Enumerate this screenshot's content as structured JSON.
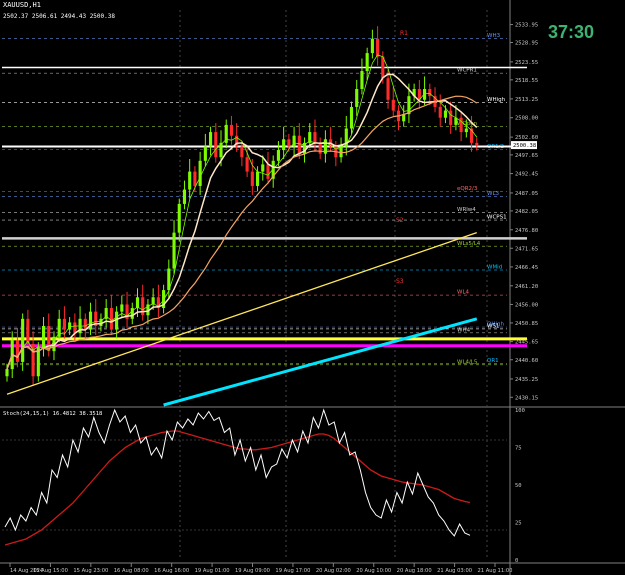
{
  "header": {
    "symbol_title": "XAUUSD,H1",
    "ohlc_readout": "2502.37 2506.61 2494.43 2500.38",
    "timer": "37:30"
  },
  "colors": {
    "background": "#000000",
    "grid": "#1e1e1e",
    "bull": "#7CFC00",
    "bear": "#ff2a2a",
    "ma_fast": "#ffe8c8",
    "ma_mid": "#f4a460",
    "ma_slow": "#ffe65a",
    "ma_long": "#00e5ff",
    "magenta": "#ff00ff",
    "yellow": "#ffff33",
    "timer": "#3cb371",
    "axis_text": "#c8c8c8"
  },
  "chart_data": [
    {
      "type": "candlestick",
      "title": "",
      "price_axis": {
        "range": [
          2428,
          2538
        ],
        "ticks": [
          2533.95,
          2528.95,
          2523.55,
          2518.55,
          2513.25,
          2508.0,
          2502.6,
          2497.65,
          2492.45,
          2487.05,
          2482.05,
          2476.8,
          2471.65,
          2466.45,
          2461.2,
          2456.0,
          2450.85,
          2445.65,
          2440.6,
          2435.25,
          2430.15
        ],
        "current_price": 2500.38
      },
      "time_labels": [
        "14 Aug 2024",
        "15 Aug 15:00",
        "15 Aug 23:00",
        "16 Aug 08:00",
        "16 Aug 16:00",
        "19 Aug 01:00",
        "19 Aug 09:00",
        "19 Aug 17:00",
        "20 Aug 02:00",
        "20 Aug 10:00",
        "20 Aug 18:00",
        "21 Aug 03:00",
        "21 Aug 11:00"
      ],
      "close_series": [
        2438,
        2446,
        2440,
        2452,
        2445,
        2436,
        2444,
        2450,
        2443,
        2447,
        2452,
        2449,
        2451,
        2448,
        2452,
        2449,
        2454,
        2450,
        2452,
        2455,
        2449,
        2454,
        2456,
        2452,
        2455,
        2458,
        2453,
        2456,
        2458,
        2455,
        2460,
        2466,
        2476,
        2484,
        2488,
        2493,
        2489,
        2496,
        2500,
        2504,
        2497,
        2501,
        2506,
        2503,
        2500,
        2497,
        2493,
        2489,
        2493,
        2495,
        2491,
        2496,
        2499,
        2502,
        2500,
        2503,
        2498,
        2501,
        2504,
        2501,
        2498,
        2502,
        2500,
        2497,
        2500,
        2505,
        2511,
        2516,
        2521,
        2526,
        2530,
        2525,
        2519,
        2513,
        2510,
        2507,
        2509,
        2514,
        2516,
        2513,
        2516,
        2514,
        2511,
        2508,
        2510,
        2506,
        2508,
        2504,
        2505,
        2501,
        2500.38
      ],
      "level_lines": [
        {
          "label": "WH3",
          "price": 2530.1
        },
        {
          "label": "WCPR1",
          "price": 2520.4
        },
        {
          "label": "WHigh",
          "price": 2512.2
        },
        {
          "label": "WOpen",
          "price": 2505.6
        },
        {
          "label": "QR1/2",
          "price": 2499.1
        },
        {
          "label": "eQR2/3",
          "price": 2487.4
        },
        {
          "label": "WL3",
          "price": 2486.1
        },
        {
          "label": "WRlw4",
          "price": 2481.6
        },
        {
          "label": "WCPS1",
          "price": 2479.5
        },
        {
          "label": "WLs5/L4",
          "price": 2472.2
        },
        {
          "label": "WMid",
          "price": 2465.6
        },
        {
          "label": "WL4",
          "price": 2458.6
        },
        {
          "label": "QHigh",
          "price": 2449.7
        },
        {
          "label": "WH4",
          "price": 2448.1
        },
        {
          "label": "WS1",
          "price": 2449.2
        },
        {
          "label": "WL4/L5",
          "price": 2439.2
        },
        {
          "label": "QR1",
          "price": 2439.6
        }
      ],
      "marker_labels": [
        "R1",
        "S2",
        "S3"
      ]
    },
    {
      "type": "line",
      "title": "Stoch(24,15,1) 16.4812 38.3518",
      "y_range": [
        0,
        100
      ],
      "ticks": [
        100,
        75,
        50,
        25,
        0
      ],
      "series": [
        {
          "values": [
            22,
            28,
            20,
            30,
            26,
            35,
            30,
            45,
            38,
            60,
            55,
            70,
            62,
            80,
            72,
            88,
            82,
            95,
            85,
            78,
            90,
            100,
            92,
            96,
            85,
            90,
            78,
            82,
            70,
            75,
            68,
            86,
            80,
            92,
            88,
            94,
            90,
            98,
            94,
            99,
            93,
            95,
            85,
            88,
            70,
            80,
            66,
            75,
            60,
            70,
            55,
            62,
            64,
            74,
            68,
            80,
            72,
            86,
            78,
            95,
            88,
            100,
            90,
            92,
            78,
            85,
            70,
            72,
            60,
            45,
            35,
            30,
            28,
            40,
            32,
            45,
            38,
            52,
            44,
            58,
            50,
            42,
            38,
            30,
            26,
            20,
            16,
            24,
            18,
            16.48
          ]
        },
        {
          "values": [
            10,
            11,
            12,
            13,
            14,
            16,
            18,
            20,
            23,
            26,
            29,
            32,
            35,
            38,
            42,
            46,
            50,
            54,
            58,
            62,
            66,
            69,
            72,
            75,
            77,
            79,
            81,
            82,
            83,
            84,
            85,
            85.5,
            86,
            86,
            85,
            84,
            83,
            82,
            81,
            80,
            79,
            78,
            77,
            76,
            75,
            74,
            74,
            73.5,
            73.5,
            74,
            74.5,
            75,
            76,
            77,
            78,
            79,
            80,
            81,
            82,
            83,
            84,
            84,
            83,
            81,
            78,
            75,
            72,
            69,
            66,
            63,
            60,
            58,
            56,
            55,
            54,
            53,
            52,
            51.5,
            51,
            50.5,
            50,
            49,
            48,
            47,
            45,
            43,
            41,
            40,
            39,
            38.35
          ]
        }
      ]
    }
  ]
}
